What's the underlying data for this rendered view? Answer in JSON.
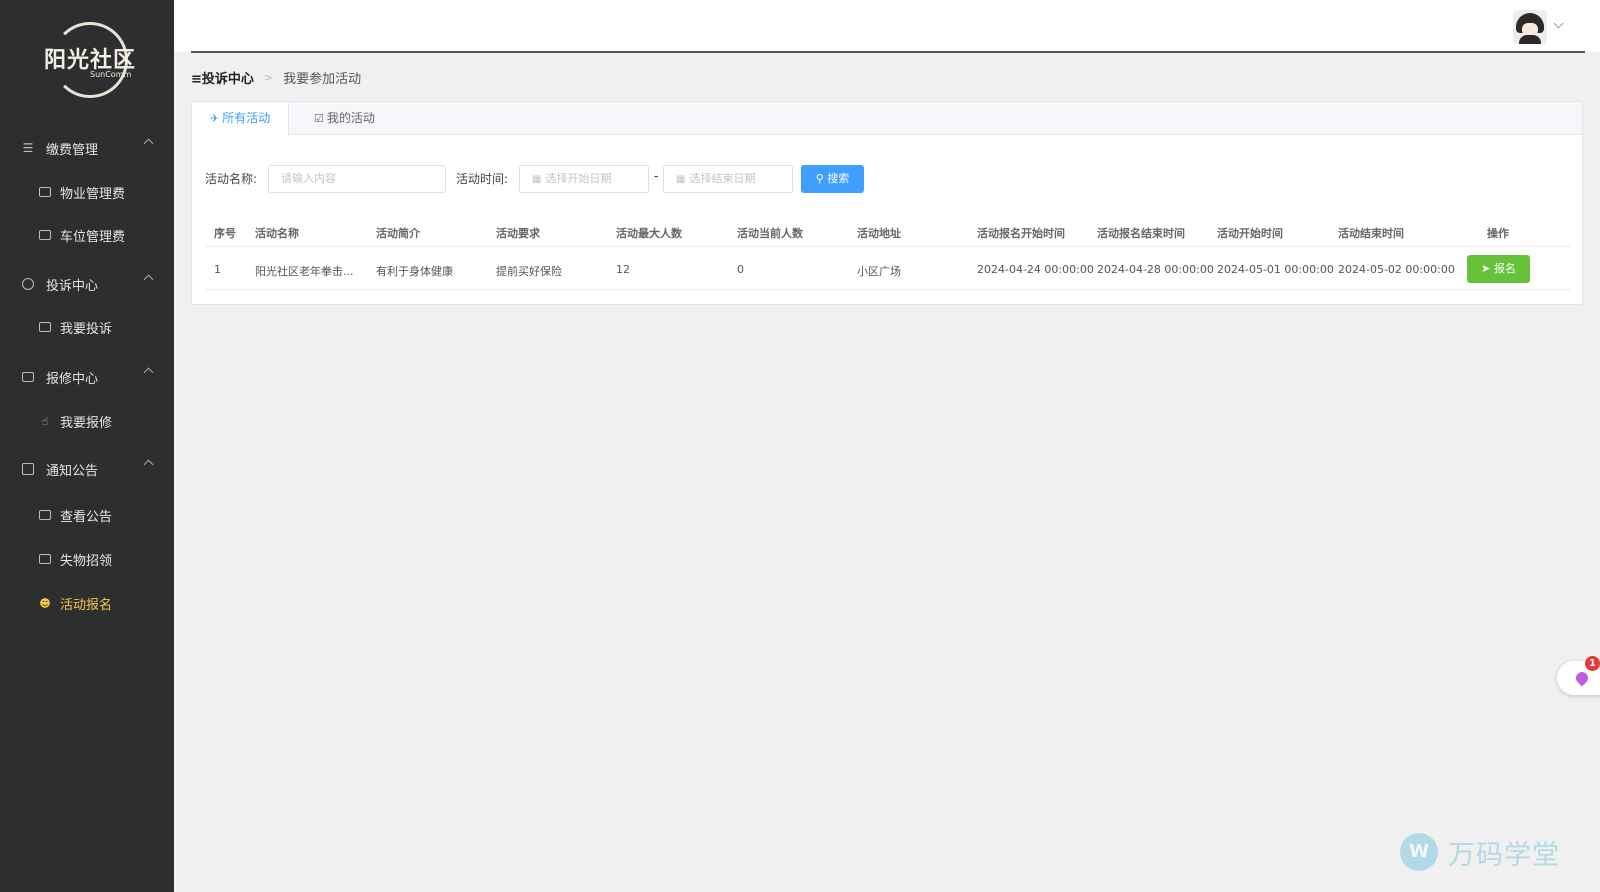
{
  "sidebar": {
    "logo_title": "阳光社区",
    "logo_sub": "SunComm",
    "groups": [
      {
        "label": "缴费管理",
        "items": [
          "物业管理费",
          "车位管理费"
        ]
      },
      {
        "label": "投诉中心",
        "items": [
          "我要投诉"
        ]
      },
      {
        "label": "报修中心",
        "items": [
          "我要报修"
        ]
      },
      {
        "label": "通知公告",
        "items": [
          "查看公告",
          "失物招领",
          "活动报名"
        ]
      }
    ],
    "active_item": "活动报名"
  },
  "breadcrumb": {
    "first": "≡投诉中心",
    "sep": ">",
    "second": "我要参加活动"
  },
  "tabs": [
    {
      "icon": "✈",
      "label": "所有活动",
      "active": true
    },
    {
      "icon": "☑",
      "label": "我的活动",
      "active": false
    }
  ],
  "filters": {
    "name_label": "活动名称:",
    "name_placeholder": "请输入内容",
    "time_label": "活动时间:",
    "start_placeholder": "选择开始日期",
    "dash": "-",
    "end_placeholder": "选择结束日期",
    "search_label": "搜索"
  },
  "table": {
    "columns": [
      "序号",
      "活动名称",
      "活动简介",
      "活动要求",
      "活动最大人数",
      "活动当前人数",
      "活动地址",
      "活动报名开始时间",
      "活动报名结束时间",
      "活动开始时间",
      "活动结束时间",
      "操作"
    ],
    "rows": [
      [
        "1",
        "阳光社区老年拳击...",
        "有利于身体健康",
        "提前买好保险",
        "12",
        "0",
        "小区广场",
        "2024-04-24 00:00:00",
        "2024-04-28 00:00:00",
        "2024-05-01 00:00:00",
        "2024-05-02 00:00:00"
      ]
    ],
    "action_label": "报名"
  },
  "float_widget": {
    "badge": "1"
  },
  "watermark": {
    "logo": "W",
    "text": "万码学堂"
  },
  "colors": {
    "sidebar_bg": "#2c2e30",
    "active": "#f7c948",
    "primary": "#409eff",
    "success": "#67c23a"
  }
}
